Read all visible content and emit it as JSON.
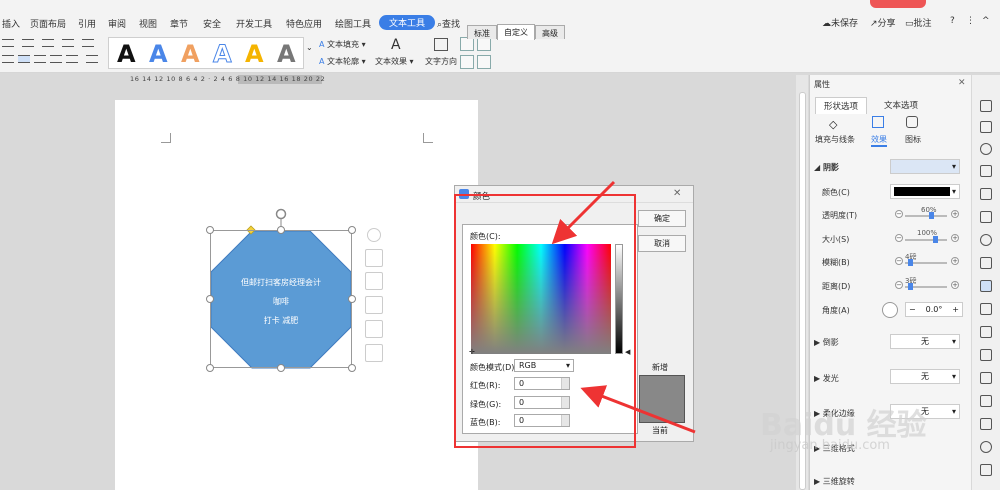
{
  "menu": {
    "tabs": [
      "插入",
      "页面布局",
      "引用",
      "审阅",
      "视图",
      "章节",
      "安全",
      "开发工具",
      "特色应用",
      "绘图工具",
      "文本工具"
    ],
    "active_tab": "文本工具",
    "search_label": "查找",
    "unsaved": "未保存",
    "share": "分享",
    "comment": "批注"
  },
  "ribbon": {
    "text_fill": "文本填充",
    "text_outline": "文本轮廓",
    "text_effect": "文本效果",
    "text_direction": "文字方向",
    "style_letters": [
      "A",
      "A",
      "A",
      "A",
      "A",
      "A"
    ]
  },
  "ruler": {
    "ticks": "16 14 12 10 8 6 4 2 · 2 4 6 8 10 12 14 16 18 20 22"
  },
  "document": {
    "shape_lines": [
      "但邮打扫客房经理会计",
      "咖啡",
      "打卡 减肥"
    ]
  },
  "color_dialog": {
    "title": "颜色",
    "tabs": [
      "标准",
      "自定义",
      "高级"
    ],
    "active_tab": "自定义",
    "color_label": "颜色(C):",
    "mode_label": "颜色模式(D)",
    "mode_value": "RGB",
    "red_label": "红色(R):",
    "green_label": "绿色(G):",
    "blue_label": "蓝色(B):",
    "red": "0",
    "green": "0",
    "blue": "0",
    "ok": "确定",
    "cancel": "取消",
    "new_label": "新增",
    "current_label": "当前",
    "new_color": "#888888"
  },
  "panel": {
    "title": "属性",
    "tabs": [
      "形状选项",
      "文本选项"
    ],
    "active_tab": "形状选项",
    "subtabs": [
      "填充与线条",
      "效果",
      "图标"
    ],
    "active_subtab": "效果",
    "shadow_section": "阴影",
    "color_label": "颜色(C)",
    "transparency_label": "透明度(T)",
    "transparency_value": "60%",
    "size_label": "大小(S)",
    "size_value": "100%",
    "blur_label": "模糊(B)",
    "blur_value": "4磅",
    "distance_label": "距离(D)",
    "distance_value": "3磅",
    "angle_label": "角度(A)",
    "angle_value": "0.0°",
    "reflection_section": "倒影",
    "reflection_value": "无",
    "glow_section": "发光",
    "glow_value": "无",
    "soft_edge_section": "柔化边缘",
    "soft_edge_value": "无",
    "threed_format": "三维格式",
    "threed_rotation": "三维旋转"
  },
  "watermark": {
    "text": "Baidu 经验",
    "url": "jingyan.baidu.com"
  },
  "colors": {
    "accent": "#3a7ee6",
    "shape_fill": "#5b9bd5",
    "annotation": "#e33333"
  }
}
